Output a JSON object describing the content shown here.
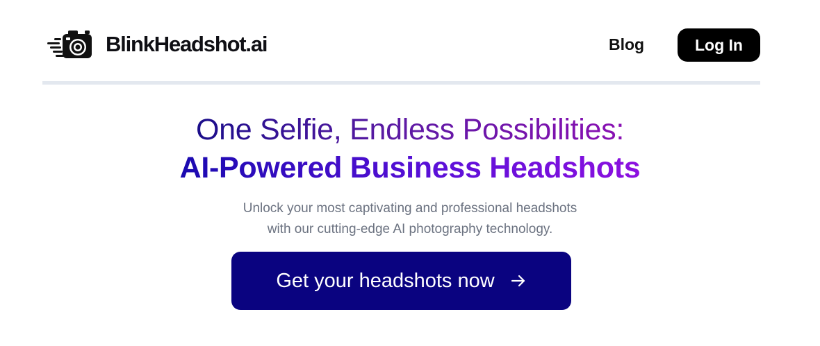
{
  "brand": {
    "name": "BlinkHeadshot.ai",
    "logo_icon": "camera-speed-icon"
  },
  "nav": {
    "blog_label": "Blog",
    "login_label": "Log In"
  },
  "hero": {
    "headline_line1": "One Selfie, Endless Possibilities:",
    "headline_line2": "AI-Powered Business Headshots",
    "subtitle_line1": "Unlock your most captivating and professional headshots",
    "subtitle_line2": "with our cutting-edge AI photography technology.",
    "cta_label": "Get your headshots now",
    "cta_icon": "arrow-right-icon"
  },
  "colors": {
    "cta_background": "#0a0380",
    "login_background": "#000000",
    "headline_gradient_start": "#1a0ab0",
    "headline_gradient_end": "#8d10e0",
    "subtitle_text": "#6b7280",
    "divider": "#e3e8ef"
  }
}
